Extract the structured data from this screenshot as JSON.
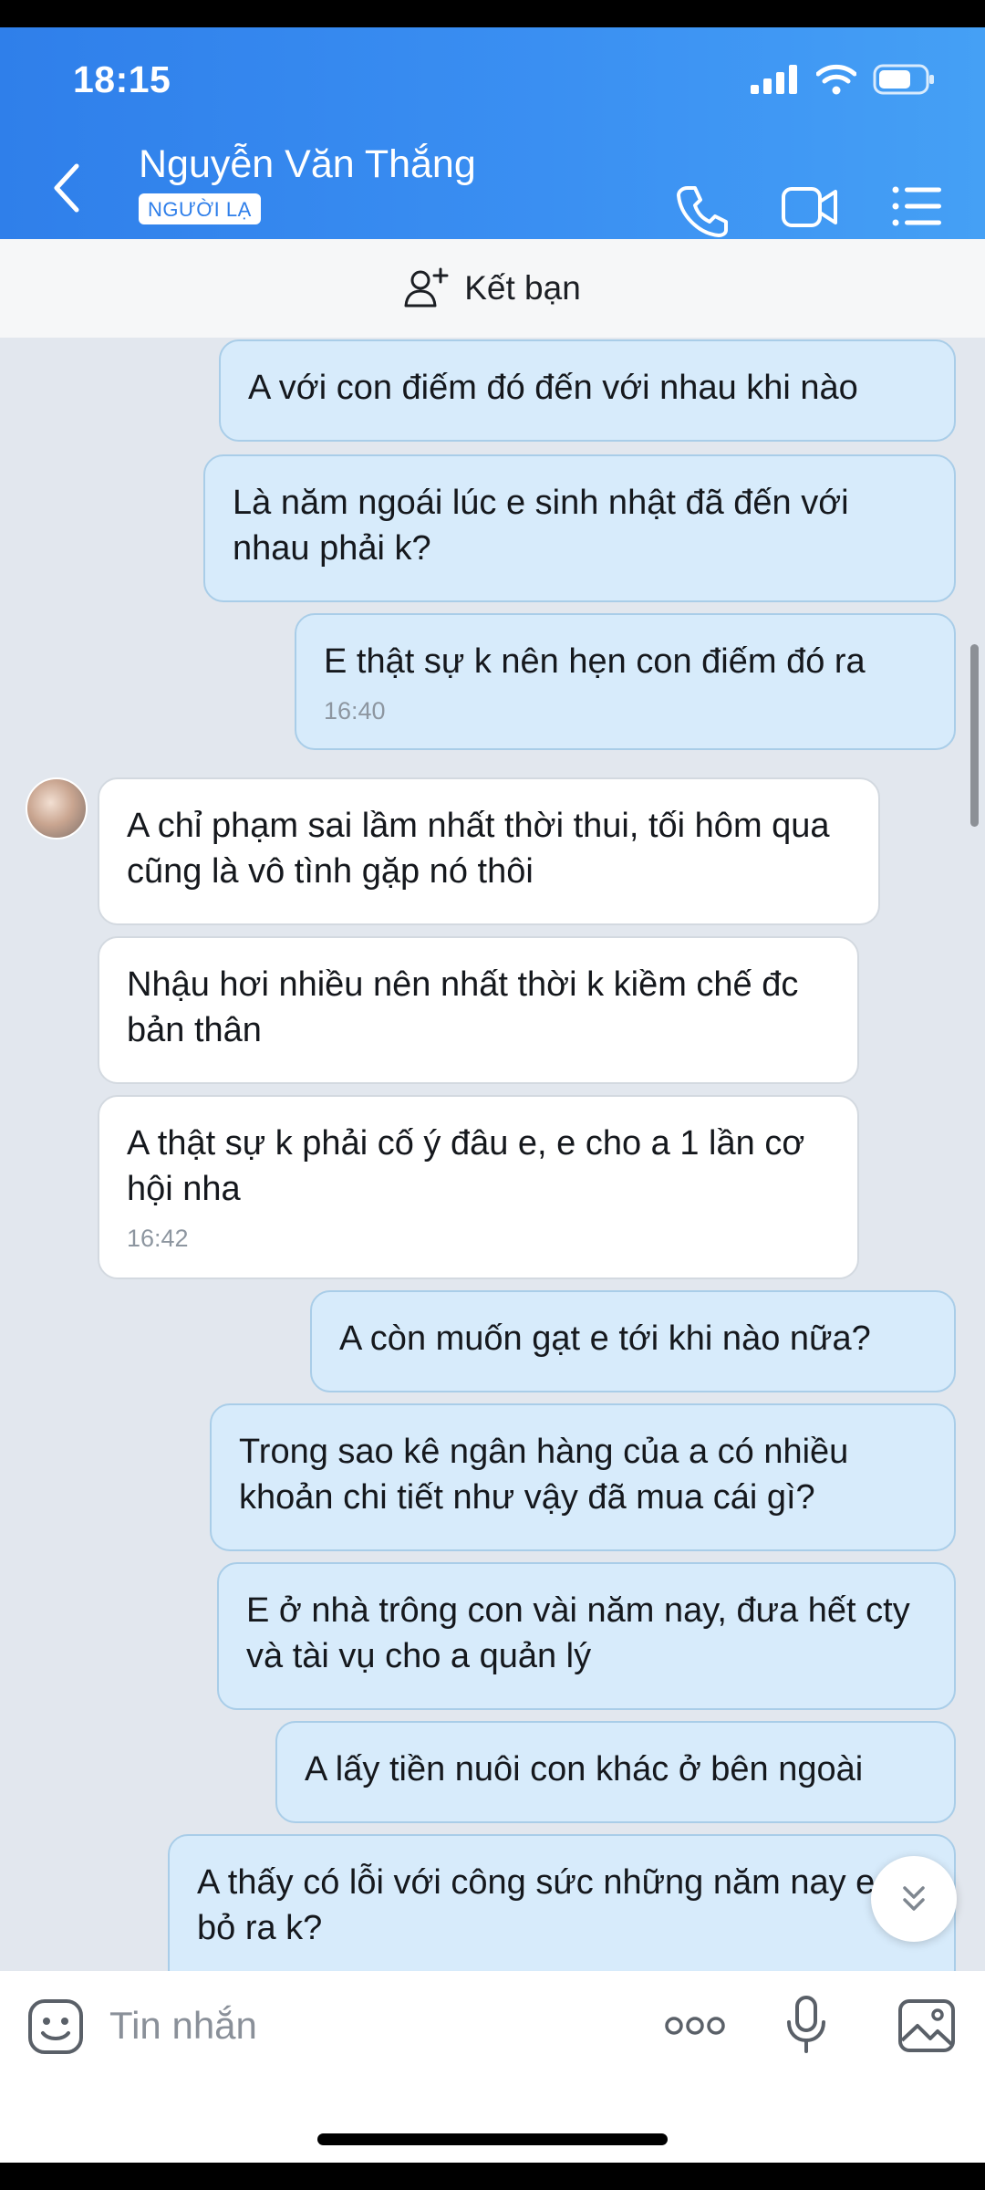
{
  "status": {
    "time": "18:15"
  },
  "header": {
    "contact_name": "Nguyễn Văn Thắng",
    "badge": "NGƯỜI LẠ"
  },
  "friend_bar": {
    "label": "Kết bạn"
  },
  "messages": [
    {
      "dir": "out",
      "text": "A với con điếm đó đến với nhau khi nào"
    },
    {
      "dir": "out",
      "text": "Là năm ngoái lúc e sinh nhật đã đến với nhau phải k?"
    },
    {
      "dir": "out",
      "text": "E thật sự k nên hẹn con điếm đó ra",
      "time": "16:40"
    },
    {
      "dir": "in",
      "text": "A chỉ phạm sai lầm nhất thời thui, tối hôm qua cũng là vô tình gặp nó thôi"
    },
    {
      "dir": "in",
      "text": "Nhậu hơi nhiều nên nhất thời k kiềm chế đc bản thân"
    },
    {
      "dir": "in",
      "text": "A thật sự k phải cố ý đâu e, e cho a 1 lần cơ hội nha",
      "time": "16:42"
    },
    {
      "dir": "out",
      "text": "A còn muốn gạt e tới khi nào nữa?"
    },
    {
      "dir": "out",
      "text": "Trong sao kê ngân hàng của a có nhiều khoản chi tiết như vậy đã mua cái gì?"
    },
    {
      "dir": "out",
      "text": "E ở nhà trông con vài năm nay, đưa hết cty và tài vụ cho a quản lý"
    },
    {
      "dir": "out",
      "text": "A lấy tiền nuôi con khác ở bên ngoài"
    },
    {
      "dir": "out",
      "text": "A thấy có lỗi với công sức những năm nay e đã bỏ ra k?"
    }
  ],
  "input": {
    "placeholder": "Tin nhắn"
  },
  "colors": {
    "header_blue": "#2f7fea",
    "outgoing_bubble": "#d7ebfb",
    "incoming_bubble": "#ffffff",
    "chat_bg": "#e2e7ee"
  },
  "icons": [
    "back-icon",
    "phone-icon",
    "video-call-icon",
    "menu-icon",
    "add-friend-icon",
    "scroll-down-icon",
    "sticker-icon",
    "more-icon",
    "microphone-icon",
    "image-icon"
  ]
}
